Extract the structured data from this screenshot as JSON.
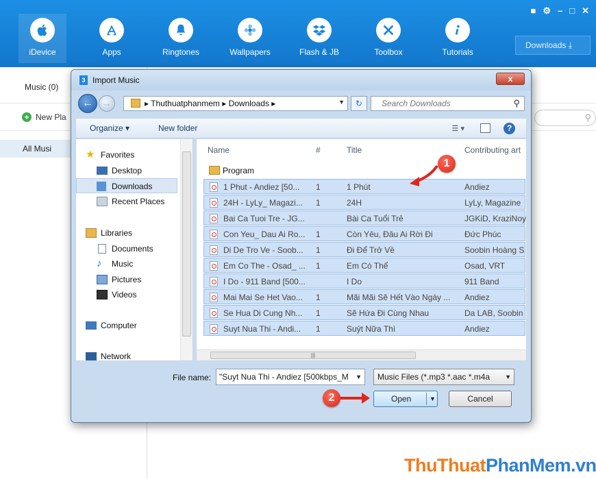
{
  "app": {
    "nav": [
      {
        "label": "iDevice",
        "icon": "apple-icon"
      },
      {
        "label": "Apps",
        "icon": "appstore-icon"
      },
      {
        "label": "Ringtones",
        "icon": "bell-icon"
      },
      {
        "label": "Wallpapers",
        "icon": "flower-icon"
      },
      {
        "label": "Flash & JB",
        "icon": "dropbox-icon"
      },
      {
        "label": "Toolbox",
        "icon": "tools-icon"
      },
      {
        "label": "Tutorials",
        "icon": "info-icon"
      }
    ],
    "downloads_label": "Downloads",
    "music_tab": "Music (0)",
    "new_playlist": "New Pla",
    "all_music": "All Musi"
  },
  "dialog": {
    "title": "Import Music",
    "close_label": "x",
    "breadcrumb": [
      "Thuthuatphanmem",
      "Downloads"
    ],
    "search_placeholder": "Search Downloads",
    "toolbar": {
      "organize": "Organize",
      "new_folder": "New folder"
    },
    "nav_pane": {
      "favorites": "Favorites",
      "items": [
        "Desktop",
        "Downloads",
        "Recent Places"
      ],
      "libraries": "Libraries",
      "lib_items": [
        "Documents",
        "Music",
        "Pictures",
        "Videos"
      ],
      "computer": "Computer",
      "network": "Network"
    },
    "columns": {
      "name": "Name",
      "num": "#",
      "title": "Title",
      "artist": "Contributing art"
    },
    "folder": "Program",
    "files": [
      {
        "name": "1 Phut - Andiez [50...",
        "num": "1",
        "title": "1 Phút",
        "artist": "Andiez"
      },
      {
        "name": "24H - LyLy_ Magazi...",
        "num": "1",
        "title": "24H",
        "artist": "LyLy, Magazine"
      },
      {
        "name": "Bai Ca Tuoi Tre - JG...",
        "num": "",
        "title": "Bài Ca Tuổi Trẻ",
        "artist": "JGKiD, KraziNoy"
      },
      {
        "name": "Con Yeu_ Dau Ai Ro...",
        "num": "1",
        "title": "Còn Yêu, Đâu Ai Rời Đi",
        "artist": "Đức Phúc"
      },
      {
        "name": "Di De Tro Ve - Soob...",
        "num": "1",
        "title": "Đi Để Trở Về",
        "artist": "Soobin Hoàng S"
      },
      {
        "name": "Em Co The - Osad_ ...",
        "num": "1",
        "title": "Em Có Thể",
        "artist": "Osad, VRT"
      },
      {
        "name": "I Do - 911 Band [500...",
        "num": "",
        "title": "I Do",
        "artist": "911 Band"
      },
      {
        "name": "Mai Mai Se Het Vao...",
        "num": "1",
        "title": "Mãi Mãi Sẽ Hết Vào Ngày ...",
        "artist": "Andiez"
      },
      {
        "name": "Se Hua Di Cung Nh...",
        "num": "1",
        "title": "Sẽ Hứa Đi Cùng Nhau",
        "artist": "Da LAB, Soobin"
      },
      {
        "name": "Suyt Nua Thi - Andi...",
        "num": "1",
        "title": "Suýt Nữa Thì",
        "artist": "Andiez"
      }
    ],
    "file_name_label": "File name:",
    "file_name_value": "\"Suyt Nua Thi - Andiez [500kbps_M",
    "file_type_value": "Music Files (*.mp3 *.aac *.m4a",
    "open_label": "Open",
    "cancel_label": "Cancel"
  },
  "annotations": {
    "step1": "1",
    "step2": "2"
  },
  "watermark": {
    "part1": "ThuThuat",
    "part2": "PhanMem",
    "part3": ".vn"
  },
  "colors": {
    "topbar": "#1a86dc",
    "selection": "#cfe1f6",
    "badge": "#e0261a",
    "watermark_orange": "#f07c1e",
    "watermark_blue": "#2e7fd0"
  }
}
